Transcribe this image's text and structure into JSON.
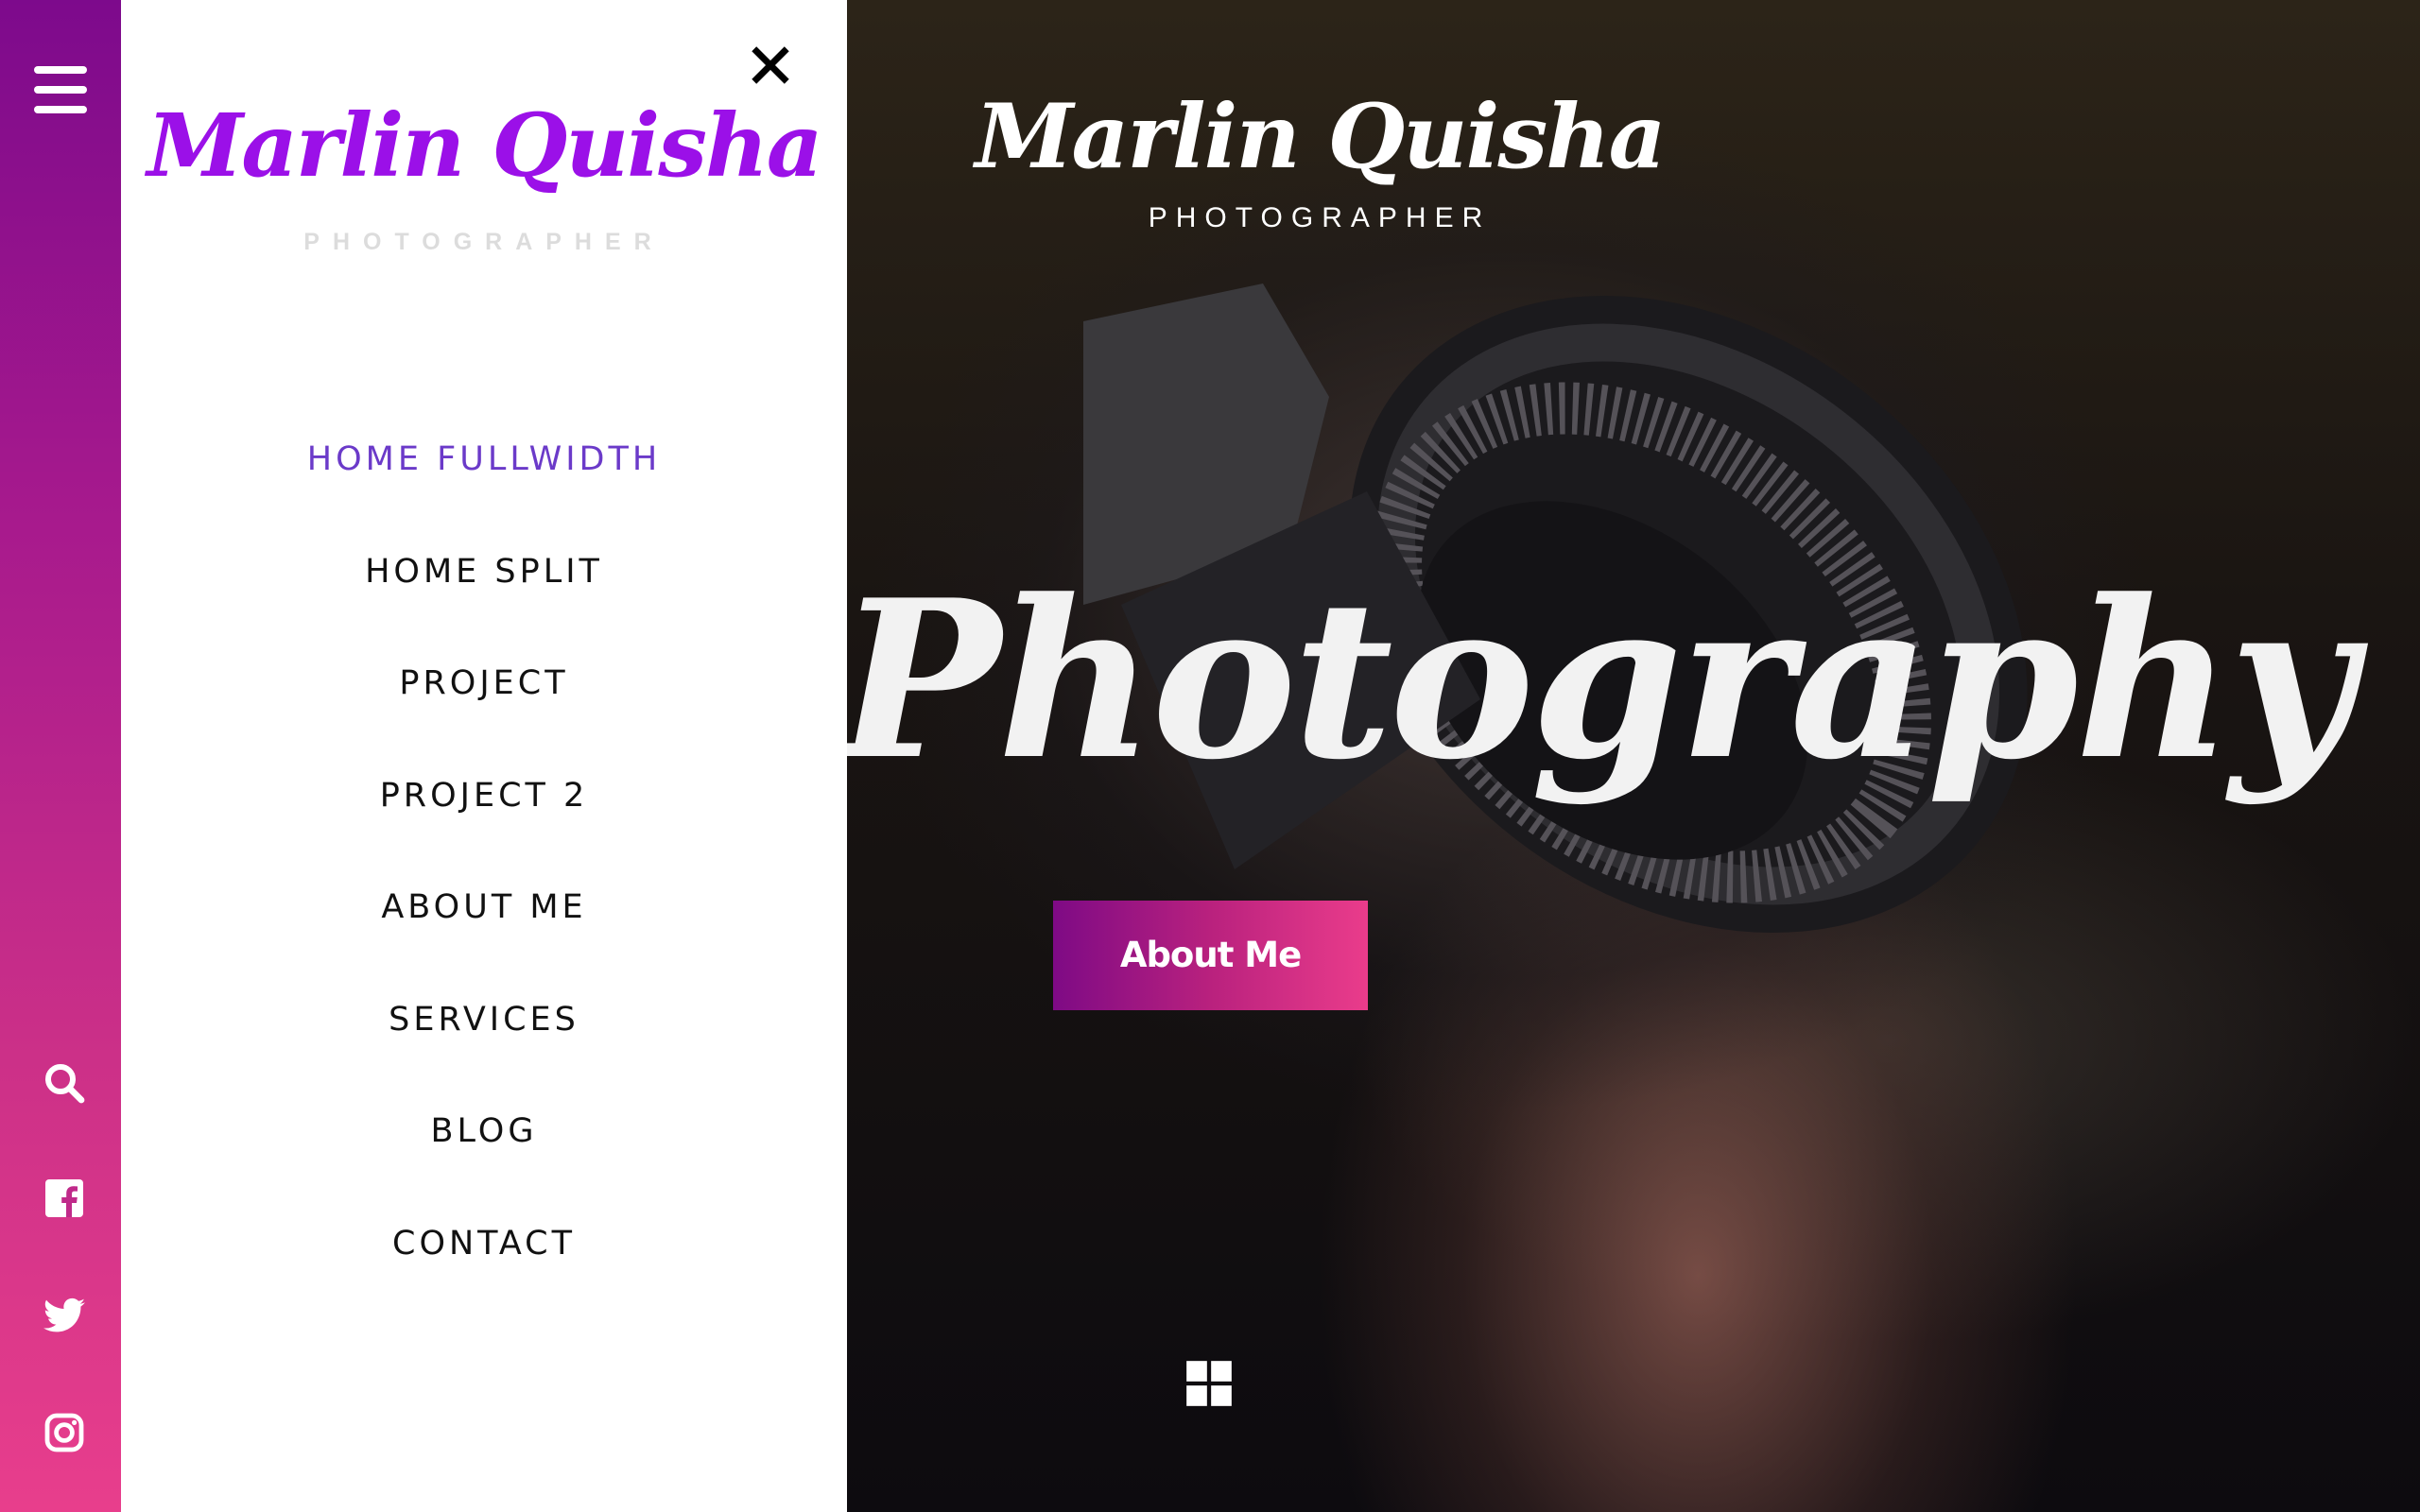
{
  "brand": {
    "name": "Marlin Quisha",
    "tagline": "PHOTOGRAPHER",
    "accent_purple": "#9b10e8",
    "gradient_start": "#7d0a8c",
    "gradient_end": "#e83e8c"
  },
  "sidebar": {
    "menu_icon": "hamburger-icon",
    "icons": [
      "search-icon",
      "facebook-icon",
      "twitter-icon",
      "instagram-icon"
    ]
  },
  "drawer": {
    "close_icon": "close-icon",
    "menu": [
      {
        "label": "HOME FULLWIDTH",
        "active": true
      },
      {
        "label": "HOME SPLIT",
        "active": false
      },
      {
        "label": "PROJECT",
        "active": false
      },
      {
        "label": "PROJECT 2",
        "active": false
      },
      {
        "label": "ABOUT ME",
        "active": false
      },
      {
        "label": "SERVICES",
        "active": false
      },
      {
        "label": "BLOG",
        "active": false
      },
      {
        "label": "CONTACT",
        "active": false
      }
    ],
    "active_color": "#6b3ac9"
  },
  "hero": {
    "title": "Photography",
    "button_label": "About Me",
    "bottom_icon": "grid-icon"
  }
}
